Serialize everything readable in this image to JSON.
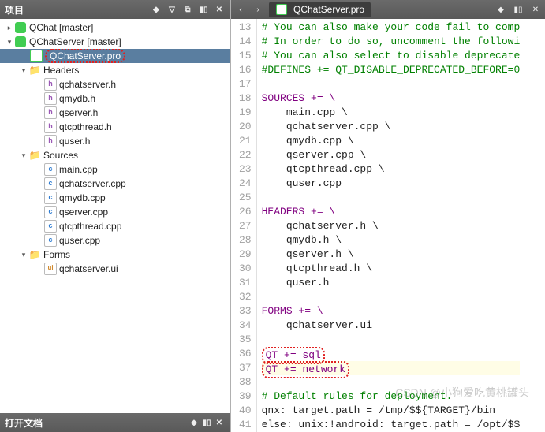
{
  "leftPanel": {
    "title": "项目",
    "openDocs": "打开文档"
  },
  "tree": {
    "qchat": "QChat [master]",
    "qchatserver": "QChatServer [master]",
    "proFile": "QChatServer.pro",
    "headers": {
      "label": "Headers",
      "items": [
        "qchatserver.h",
        "qmydb.h",
        "qserver.h",
        "qtcpthread.h",
        "quser.h"
      ]
    },
    "sources": {
      "label": "Sources",
      "items": [
        "main.cpp",
        "qchatserver.cpp",
        "qmydb.cpp",
        "qserver.cpp",
        "qtcpthread.cpp",
        "quser.cpp"
      ]
    },
    "forms": {
      "label": "Forms",
      "items": [
        "qchatserver.ui"
      ]
    }
  },
  "editor": {
    "tab": "QChatServer.pro",
    "firstLine": 13,
    "currentLine": 37,
    "highlightLines": [
      36,
      37
    ],
    "lines": [
      {
        "t": "# You can also make your code fail to comp",
        "c": "cmnt"
      },
      {
        "t": "# In order to do so, uncomment the followi",
        "c": "cmnt"
      },
      {
        "t": "# You can also select to disable deprecate",
        "c": "cmnt"
      },
      {
        "t": "#DEFINES += QT_DISABLE_DEPRECATED_BEFORE=0",
        "c": "cmnt"
      },
      {
        "t": "",
        "c": ""
      },
      {
        "t": "SOURCES += \\",
        "c": "kw"
      },
      {
        "t": "    main.cpp \\",
        "c": ""
      },
      {
        "t": "    qchatserver.cpp \\",
        "c": ""
      },
      {
        "t": "    qmydb.cpp \\",
        "c": ""
      },
      {
        "t": "    qserver.cpp \\",
        "c": ""
      },
      {
        "t": "    qtcpthread.cpp \\",
        "c": ""
      },
      {
        "t": "    quser.cpp",
        "c": ""
      },
      {
        "t": "",
        "c": ""
      },
      {
        "t": "HEADERS += \\",
        "c": "kw"
      },
      {
        "t": "    qchatserver.h \\",
        "c": ""
      },
      {
        "t": "    qmydb.h \\",
        "c": ""
      },
      {
        "t": "    qserver.h \\",
        "c": ""
      },
      {
        "t": "    qtcpthread.h \\",
        "c": ""
      },
      {
        "t": "    quser.h",
        "c": ""
      },
      {
        "t": "",
        "c": ""
      },
      {
        "t": "FORMS += \\",
        "c": "kw"
      },
      {
        "t": "    qchatserver.ui",
        "c": ""
      },
      {
        "t": "",
        "c": ""
      },
      {
        "t": "QT += sql",
        "c": "kw"
      },
      {
        "t": "QT += network",
        "c": "kw"
      },
      {
        "t": "",
        "c": ""
      },
      {
        "t": "# Default rules for deployment.",
        "c": "cmnt"
      },
      {
        "t": "qnx: target.path = /tmp/$${TARGET}/bin",
        "c": ""
      },
      {
        "t": "else: unix:!android: target.path = /opt/$$",
        "c": ""
      }
    ]
  },
  "watermark": "CSDN @小狗爱吃黄桃罐头"
}
